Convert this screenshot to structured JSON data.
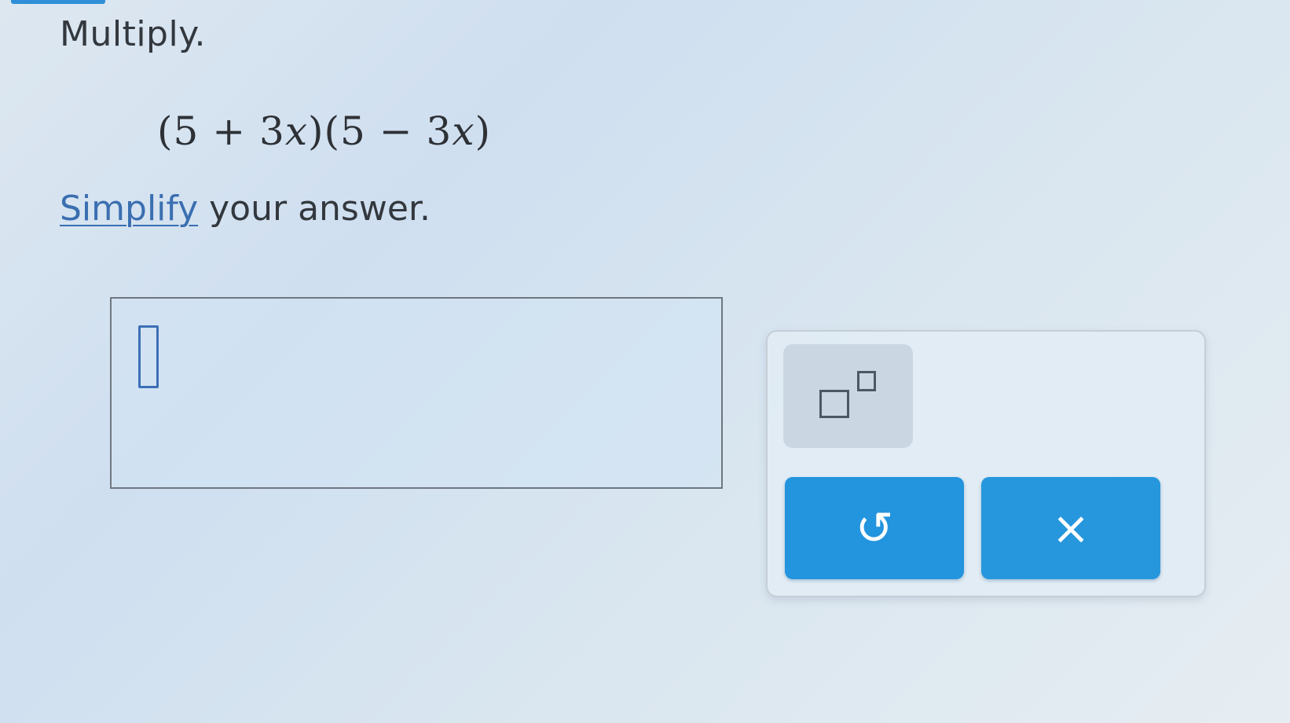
{
  "question": {
    "instruction": "Multiply.",
    "expression": {
      "factor1_open": "(5 + 3",
      "factor1_var": "x",
      "factor1_close": ")",
      "factor2_open": "(5 − 3",
      "factor2_var": "x",
      "factor2_close": ")"
    },
    "simplify_link": "Simplify",
    "simplify_rest": " your answer."
  },
  "answer": {
    "value": ""
  },
  "keypad": {
    "exponent_icon": "exponent-template-icon",
    "undo_icon": "↺",
    "clear_icon": "×"
  },
  "colors": {
    "accent": "#2394de",
    "link": "#3a6fb0"
  }
}
